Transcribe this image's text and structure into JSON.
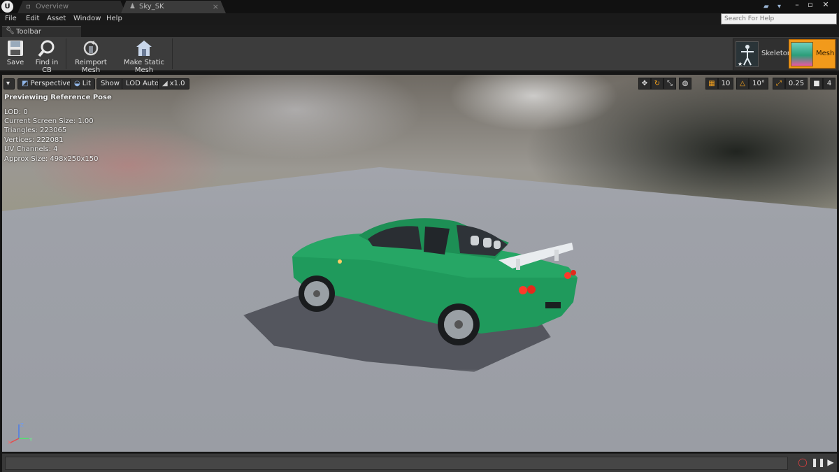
{
  "window": {
    "logo": "U",
    "tabs": [
      {
        "label": "Overview",
        "active": false
      },
      {
        "label": "Sky_SK",
        "active": true
      }
    ],
    "controls": [
      "minimize-icon",
      "maximize-icon",
      "close-icon"
    ]
  },
  "menu": {
    "items": [
      "File",
      "Edit",
      "Asset",
      "Window",
      "Help"
    ],
    "help_search_placeholder": "Search For Help"
  },
  "toolbar": {
    "tab_label": "Toolbar",
    "buttons": [
      {
        "label": "Save",
        "icon": "save-icon"
      },
      {
        "label": "Find in CB",
        "icon": "magnifier-icon"
      },
      {
        "label": "Reimport Mesh",
        "icon": "reimport-icon"
      },
      {
        "label": "Make Static Mesh",
        "icon": "static-mesh-icon"
      }
    ],
    "modes": {
      "skeleton_label": "Skeleton",
      "mesh_label": "Mesh",
      "active_mode": "Mesh",
      "active_color": "#f29a1b"
    }
  },
  "viewport": {
    "perspective_label": "Perspective",
    "lit_label": "Lit",
    "show_label": "Show",
    "lod_label": "LOD Auto",
    "speed_label": "x1.0",
    "pose_label": "Previewing Reference Pose",
    "stats": [
      "LOD: 0",
      "Current Screen Size: 1.00",
      "Triangles: 223065",
      "Vertices: 222081",
      "UV Channels: 4",
      "Approx Size: 498x250x150"
    ],
    "grid_snap": "10",
    "rotation_snap": "10°",
    "scale_snap": "0.25",
    "camera_speed": "4",
    "car_color": "#1f9a5c"
  }
}
